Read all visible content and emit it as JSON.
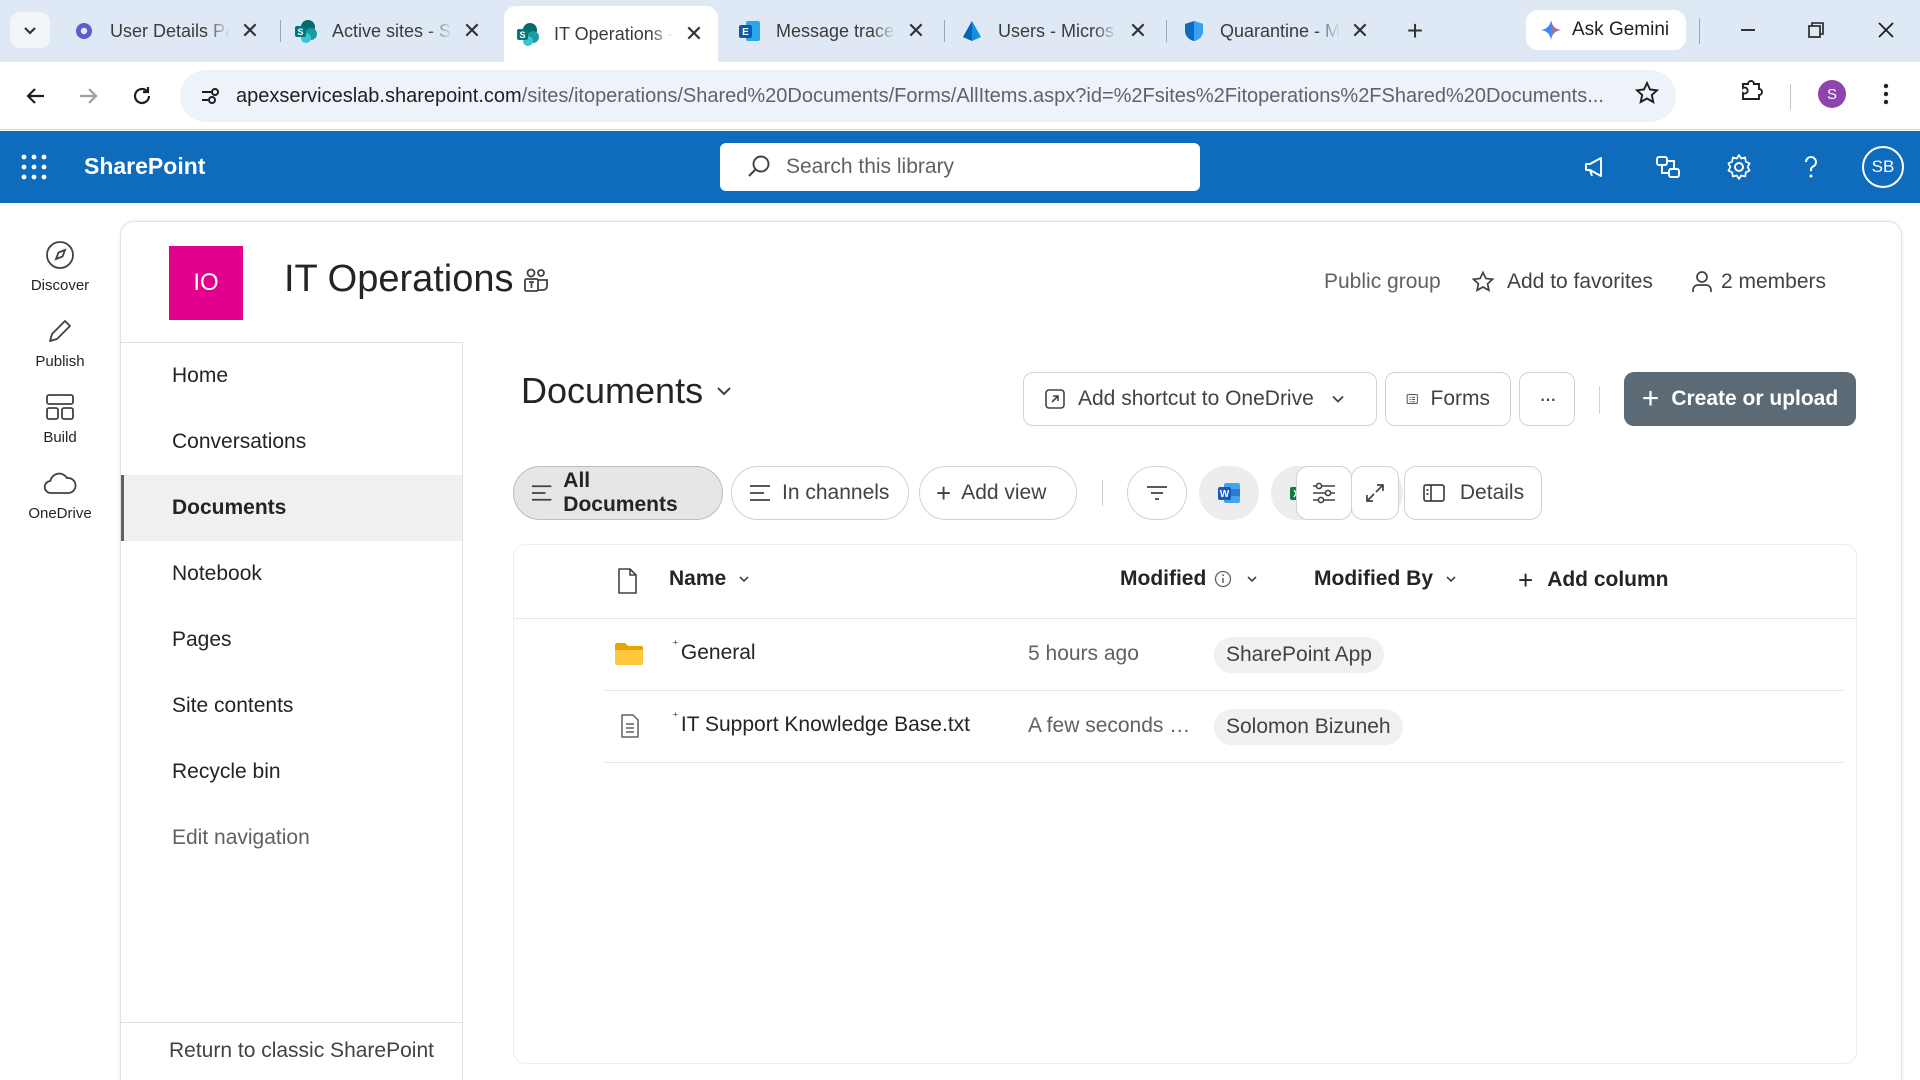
{
  "browser": {
    "tabs": [
      {
        "title": "User Details Pa",
        "favicon": "gear-icon",
        "active": false
      },
      {
        "title": "Active sites - S",
        "favicon": "sharepoint-icon",
        "active": false
      },
      {
        "title": "IT Operations -",
        "favicon": "sharepoint-icon",
        "active": true
      },
      {
        "title": "Message trace",
        "favicon": "exchange-icon",
        "active": false
      },
      {
        "title": "Users - Micros",
        "favicon": "entra-icon",
        "active": false
      },
      {
        "title": "Quarantine - M",
        "favicon": "defender-shield-icon",
        "active": false
      }
    ],
    "gemini_label": "Ask Gemini",
    "url_host": "apexserviceslab.sharepoint.com",
    "url_path": "/sites/itoperations/Shared%20Documents/Forms/AllItems.aspx?id=%2Fsites%2Fitoperations%2FShared%20Documents...",
    "profile_initial": "S"
  },
  "suitebar": {
    "brand": "SharePoint",
    "search_placeholder": "Search this library",
    "user_initials": "SB",
    "accent": "#0f6cbd"
  },
  "appbar": {
    "items": [
      {
        "label": "Discover",
        "icon": "discover-icon"
      },
      {
        "label": "Publish",
        "icon": "publish-pen-icon"
      },
      {
        "label": "Build",
        "icon": "build-icon"
      },
      {
        "label": "OneDrive",
        "icon": "onedrive-cloud-icon"
      }
    ]
  },
  "site": {
    "logo_text": "IO",
    "logo_color": "#e3008c",
    "title": "IT Operations",
    "privacy": "Public group",
    "favorites_label": "Add to favorites",
    "members_label": "2 members"
  },
  "leftnav": {
    "items": [
      {
        "label": "Home"
      },
      {
        "label": "Conversations"
      },
      {
        "label": "Documents",
        "selected": true
      },
      {
        "label": "Notebook"
      },
      {
        "label": "Pages"
      },
      {
        "label": "Site contents"
      },
      {
        "label": "Recycle bin"
      },
      {
        "label": "Edit navigation"
      }
    ],
    "return_label": "Return to classic SharePoint"
  },
  "library": {
    "title": "Documents",
    "commands": {
      "shortcut": "Add shortcut to OneDrive",
      "forms": "Forms",
      "more": "···",
      "create": "Create or upload"
    },
    "views": {
      "all_documents": "All Documents",
      "in_channels": "In channels",
      "add_view": "Add view",
      "details": "Details"
    },
    "columns": {
      "name": "Name",
      "modified": "Modified",
      "modified_by": "Modified By",
      "add_column": "Add column"
    },
    "rows": [
      {
        "name": "General",
        "type": "folder",
        "modified": "5 hours ago",
        "modified_by": "SharePoint App"
      },
      {
        "name": "IT Support Knowledge Base.txt",
        "type": "txt",
        "modified": "A few seconds ago",
        "modified_by": "Solomon Bizuneh"
      }
    ]
  }
}
